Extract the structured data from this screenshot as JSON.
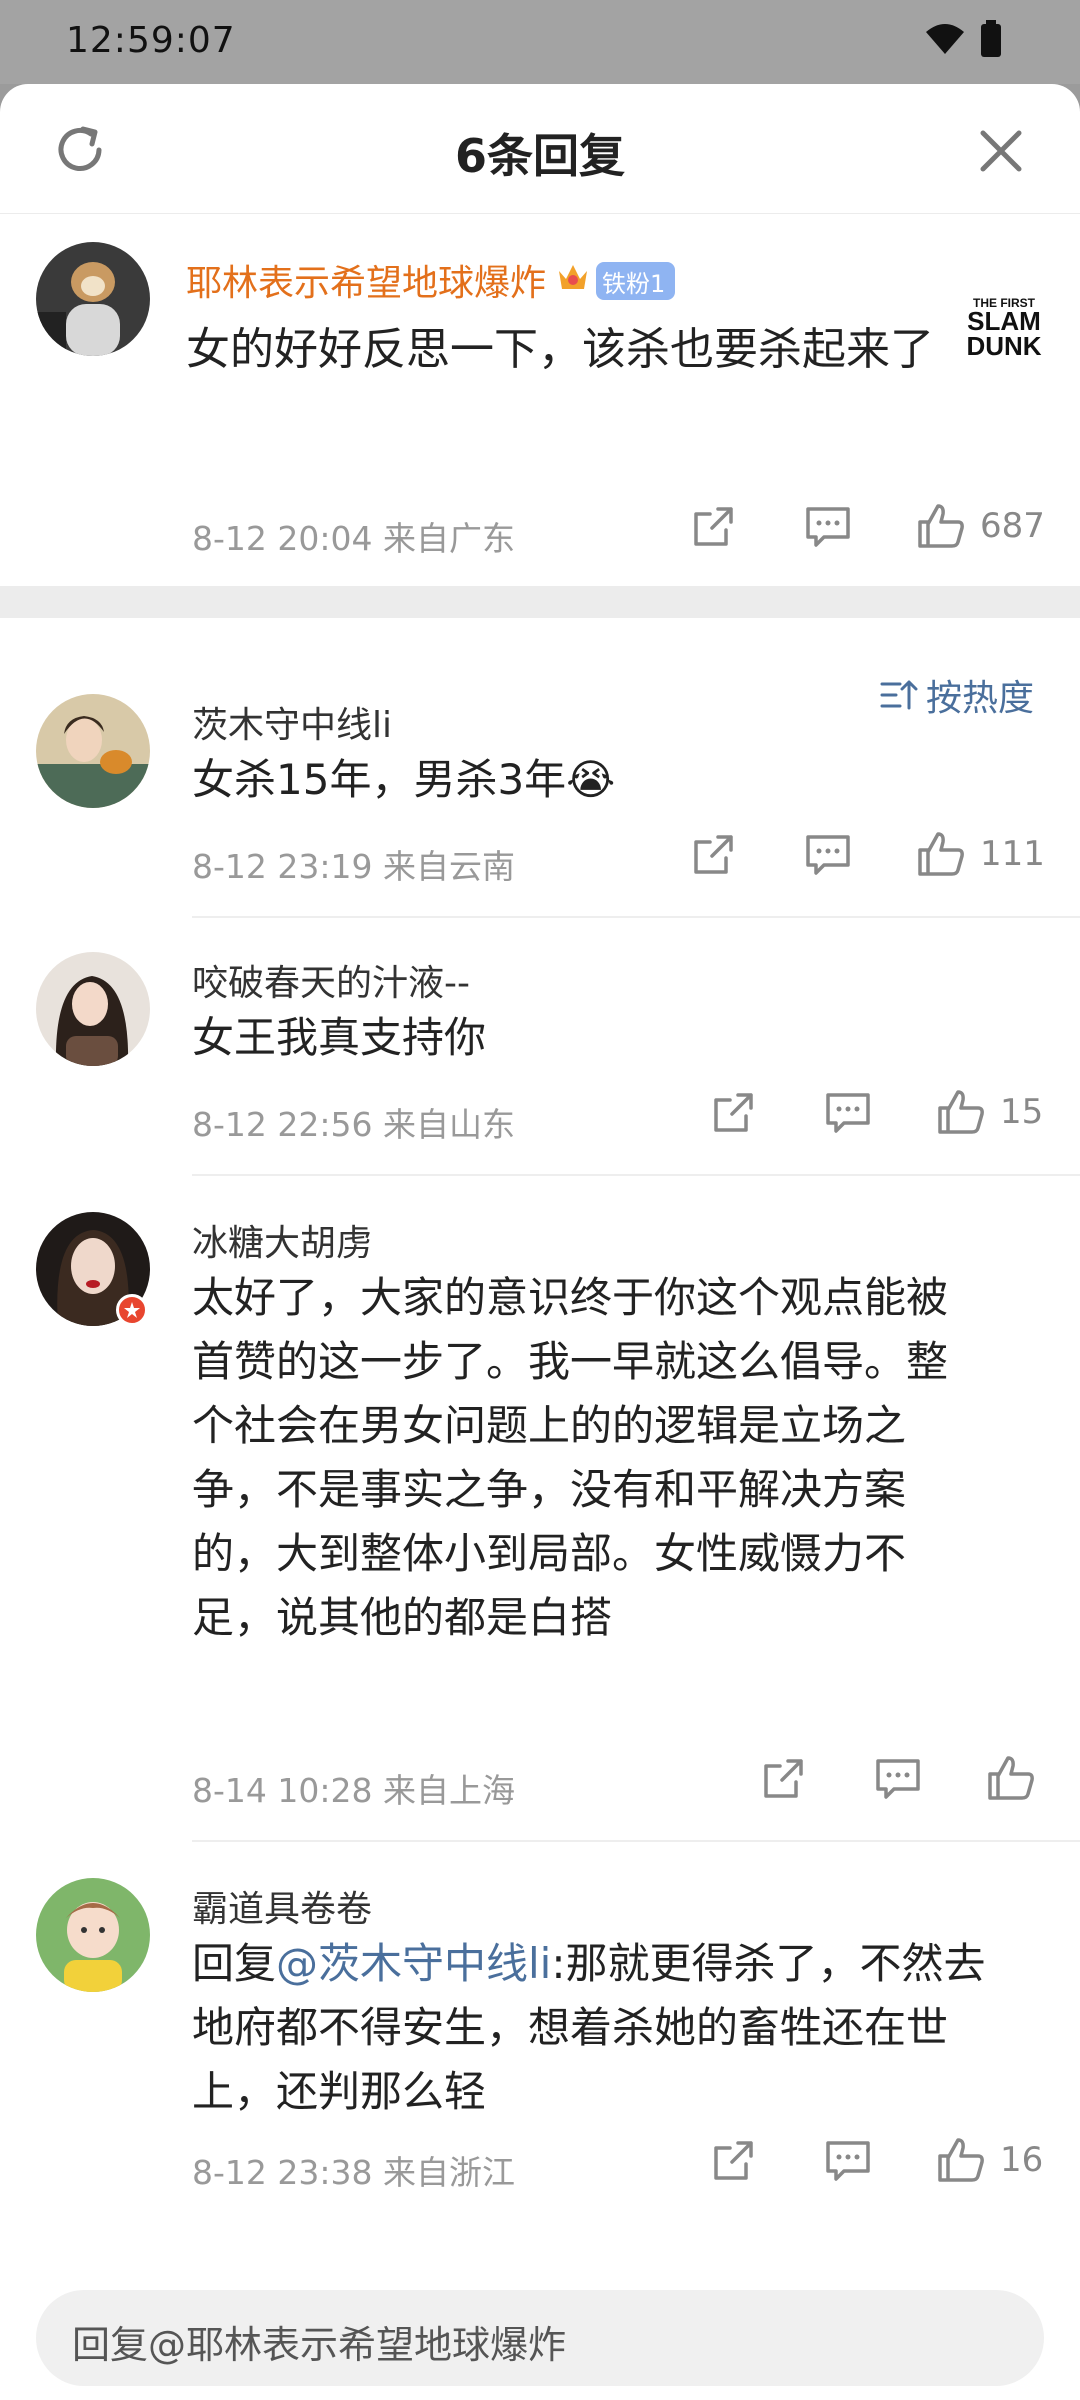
{
  "status_bar": {
    "time": "12:59:07"
  },
  "header": {
    "title": "6条回复"
  },
  "root_comment": {
    "username": "耶林表示希望地球爆炸",
    "badge": "铁粉1",
    "text": "女的好好反思一下，该杀也要杀起来了",
    "meta": "8-12 20:04  来自广东",
    "likes": "687",
    "watermark_lines": [
      "THE FIRST",
      "SLAM",
      "DUNK"
    ]
  },
  "sort": {
    "label": "按热度"
  },
  "replies": [
    {
      "username": "茨木守中线li",
      "text": "女杀15年，男杀3年😭",
      "meta": "8-12 23:19  来自云南",
      "likes": "111"
    },
    {
      "username": "咬破春天的汁液--",
      "text": "女王我真支持你",
      "meta": "8-12 22:56  来自山东",
      "likes": "15"
    },
    {
      "username": "冰糖大胡虏",
      "text_lines": [
        "太好了，大家的意识终于你这个观点能被",
        "首赞的这一步了。我一早就这么倡导。整",
        "个社会在男女问题上的的逻辑是立场之",
        "争，不是事实之争，没有和平解决方案",
        "的，大到整体小到局部。女性威慑力不",
        "足，说其他的都是白搭"
      ],
      "meta": "8-14 10:28  来自上海",
      "likes": ""
    },
    {
      "username": "霸道具卷卷",
      "reply_prefix": "回复",
      "mention": "@茨木守中线li",
      "text_after_mention": ":那就更得杀了，不然去",
      "text_lines_rest": [
        "地府都不得安生，想着杀她的畜牲还在世",
        "上，还判那么轻"
      ],
      "meta": "8-12 23:38  来自浙江",
      "likes": "16"
    }
  ],
  "reply_bar": {
    "placeholder": "回复@耶林表示希望地球爆炸"
  },
  "icons": {
    "refresh": "refresh-icon",
    "close": "close-icon",
    "share": "share-icon",
    "comment": "comment-icon",
    "like": "thumb-up-icon",
    "sort": "sort-icon",
    "wifi": "wifi-icon",
    "battery": "battery-icon"
  },
  "colors": {
    "username_highlight": "#e3701b",
    "link": "#4a6f9c",
    "meta": "#999999"
  }
}
